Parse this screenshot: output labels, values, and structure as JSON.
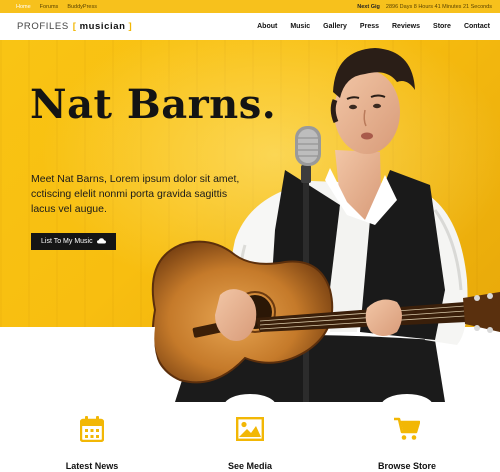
{
  "topbar": {
    "links": [
      "Home",
      "Forums",
      "BuddyPress"
    ],
    "next_gig_label": "Next Gig",
    "next_gig_countdown": "2896 Days 8 Hours 41 Minutes 21 Seconds"
  },
  "logo": {
    "left": "PROFILES",
    "right": "musician",
    "open_bracket": "[",
    "close_bracket": "]"
  },
  "nav": [
    "About",
    "Music",
    "Gallery",
    "Press",
    "Reviews",
    "Store",
    "Contact"
  ],
  "hero": {
    "title": "Nat Barns.",
    "text": "Meet Nat Barns, Lorem ipsum dolor sit amet, cctiscing elelit nonmi porta gravida sagittis lacus vel augue.",
    "button_label": "List To My Music",
    "button_icon": "cloud-icon"
  },
  "features": [
    {
      "label": "Latest News",
      "icon": "calendar-icon"
    },
    {
      "label": "See Media",
      "icon": "image-icon"
    },
    {
      "label": "Browse Store",
      "icon": "cart-icon"
    }
  ],
  "colors": {
    "accent": "#f7c11c",
    "dark": "#151515"
  }
}
